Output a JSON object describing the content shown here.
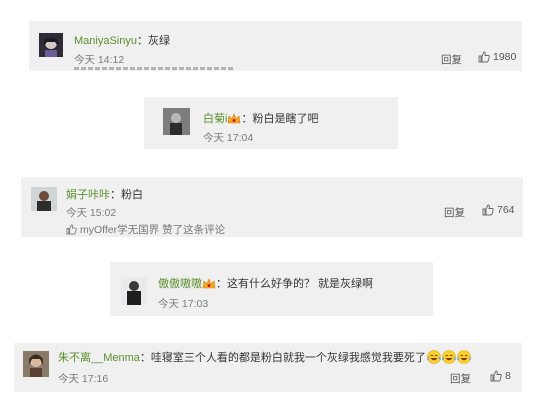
{
  "comments": [
    {
      "name": "ManiyaSinyu",
      "sep": "：",
      "text": "灰绿",
      "time": "今天 14:12",
      "reply": "回复",
      "likes": "1980"
    },
    {
      "name": "白菊i",
      "sep": "：",
      "text": "粉白是瞎了吧",
      "time": "今天 17:04"
    },
    {
      "name": "娟子咔咔",
      "sep": "：",
      "text": "粉白",
      "time": "今天 15:02",
      "reply": "回复",
      "likes": "764",
      "liked_by": "myOffer学无国界",
      "liked_text": "赞了这条评论"
    },
    {
      "name": "傲傲嗷嗷",
      "sep": "：",
      "text": "这有什么好争的？ 就是灰绿啊",
      "time": "今天 17:03"
    },
    {
      "name": "朱不离__Menma",
      "sep": "：",
      "text": "哇寝室三个人看的都是粉白就我一个灰绿我感觉我要死了",
      "time": "今天 17:16",
      "reply": "回复",
      "likes": "8"
    }
  ],
  "icons": {
    "like": "thumbs-up-icon",
    "laugh_cry": "laugh-cry-emoji-icon",
    "badge": "vip-crown-badge-icon"
  },
  "colors": {
    "card_bg": "#f0f0f0",
    "name": "#5b8f2e",
    "time": "#7a7a7a"
  }
}
